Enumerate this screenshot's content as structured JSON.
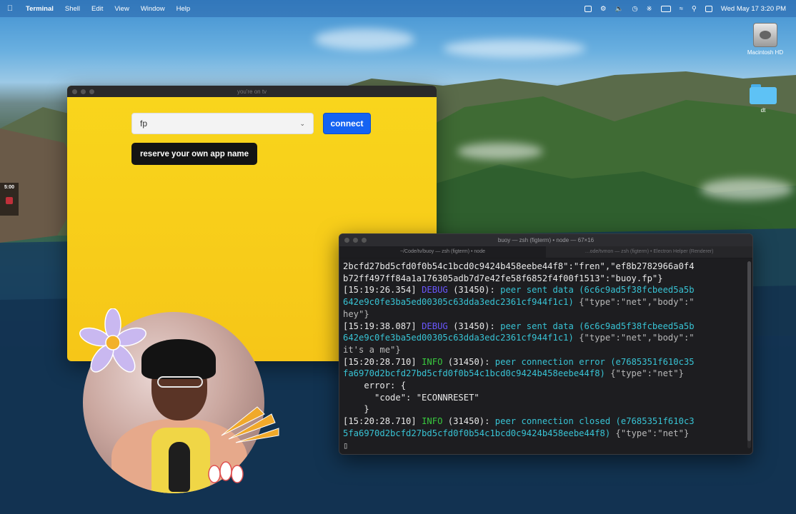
{
  "menubar": {
    "apple_icon": "apple-logo",
    "app_name": "Terminal",
    "menus": [
      "Shell",
      "Edit",
      "View",
      "Window",
      "Help"
    ],
    "datetime": "Wed May 17  3:20 PM"
  },
  "desktop": {
    "icons": [
      {
        "label": "Macintosh HD",
        "icon": "hard-drive-icon"
      },
      {
        "label": "dt",
        "icon": "folder-icon"
      }
    ],
    "side_widget_time": "5:00"
  },
  "app_window": {
    "title": "you're on tv",
    "select_value": "fp",
    "connect_label": "connect",
    "reserve_label": "reserve your own app name",
    "colors": {
      "background": "#f7cd1b",
      "connect": "#1563f2",
      "reserve": "#141414"
    }
  },
  "terminal": {
    "title": "buoy — zsh (figterm) • node — 67×16",
    "tabs": [
      "~/Code/tv/buoy — zsh (figterm) • node",
      "…ode/tvmon — zsh (figterm) • Electron Helper (Renderer)"
    ],
    "lines": [
      {
        "segments": [
          {
            "text": "2bcfd27bd5cfd0f0b54c1bcd0c9424b458eebe44f8\":\"fren\",\"ef8b2782966a0f4",
            "cls": "c-white"
          }
        ]
      },
      {
        "segments": [
          {
            "text": "b72ff497ff84a1a176305adb7d7e42fe58f6852f4f00f1513\":\"buoy.fp\"}",
            "cls": "c-white"
          }
        ]
      },
      {
        "segments": [
          {
            "text": "[15:19:26.354] ",
            "cls": "c-white"
          },
          {
            "text": "DEBUG",
            "cls": "c-blue"
          },
          {
            "text": " (31450): ",
            "cls": "c-white"
          },
          {
            "text": "peer sent data (6c6c9ad5f38fcbeed5a5b",
            "cls": "c-cyan"
          }
        ]
      },
      {
        "segments": [
          {
            "text": "642e9c0fe3ba5ed00305c63dda3edc2361cf944f1c1)",
            "cls": "c-cyan"
          },
          {
            "text": " {\"type\":\"net\",\"body\":\"",
            "cls": "c-gray"
          }
        ]
      },
      {
        "segments": [
          {
            "text": "hey\"}",
            "cls": "c-gray"
          }
        ]
      },
      {
        "segments": [
          {
            "text": "[15:19:38.087] ",
            "cls": "c-white"
          },
          {
            "text": "DEBUG",
            "cls": "c-blue"
          },
          {
            "text": " (31450): ",
            "cls": "c-white"
          },
          {
            "text": "peer sent data (6c6c9ad5f38fcbeed5a5b",
            "cls": "c-cyan"
          }
        ]
      },
      {
        "segments": [
          {
            "text": "642e9c0fe3ba5ed00305c63dda3edc2361cf944f1c1)",
            "cls": "c-cyan"
          },
          {
            "text": " {\"type\":\"net\",\"body\":\"",
            "cls": "c-gray"
          }
        ]
      },
      {
        "segments": [
          {
            "text": "it's a me\"}",
            "cls": "c-gray"
          }
        ]
      },
      {
        "segments": [
          {
            "text": "[15:20:28.710] ",
            "cls": "c-white"
          },
          {
            "text": "INFO",
            "cls": "c-green"
          },
          {
            "text": " (31450): ",
            "cls": "c-white"
          },
          {
            "text": "peer connection error (e7685351f610c35",
            "cls": "c-cyan"
          }
        ]
      },
      {
        "segments": [
          {
            "text": "fa6970d2bcfd27bd5cfd0f0b54c1bcd0c9424b458eebe44f8)",
            "cls": "c-cyan"
          },
          {
            "text": " {\"type\":\"net\"}",
            "cls": "c-gray"
          }
        ]
      },
      {
        "segments": [
          {
            "text": "    error: {",
            "cls": "c-white"
          }
        ]
      },
      {
        "segments": [
          {
            "text": "      \"code\": \"ECONNRESET\"",
            "cls": "c-white"
          }
        ]
      },
      {
        "segments": [
          {
            "text": "    }",
            "cls": "c-white"
          }
        ]
      },
      {
        "segments": [
          {
            "text": "[15:20:28.710] ",
            "cls": "c-white"
          },
          {
            "text": "INFO",
            "cls": "c-green"
          },
          {
            "text": " (31450): ",
            "cls": "c-white"
          },
          {
            "text": "peer connection closed (e7685351f610c3",
            "cls": "c-cyan"
          }
        ]
      },
      {
        "segments": [
          {
            "text": "5fa6970d2bcfd27bd5cfd0f0b54c1bcd0c9424b458eebe44f8)",
            "cls": "c-cyan"
          },
          {
            "text": " {\"type\":\"net\"}",
            "cls": "c-gray"
          }
        ]
      },
      {
        "segments": [
          {
            "text": "▯",
            "cls": "c-gray"
          }
        ]
      }
    ]
  }
}
